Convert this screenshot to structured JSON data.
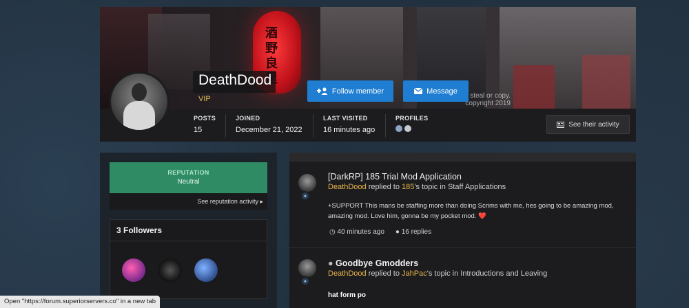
{
  "cover": {
    "lantern_text": "酒野良里",
    "watermark_line1": "steal or copy.",
    "watermark_line2": "copyright 2019"
  },
  "profile": {
    "username": "DeathDood",
    "usergroup": "VIP",
    "follow_label": "Follow member",
    "message_label": "Message",
    "stats": [
      {
        "key": "POSTS",
        "value": "15"
      },
      {
        "key": "JOINED",
        "value": "December 21, 2022"
      },
      {
        "key": "LAST VISITED",
        "value": "16 minutes ago"
      },
      {
        "key": "PROFILES",
        "value": ""
      }
    ],
    "activity_label": "See their activity"
  },
  "reputation": {
    "label": "REPUTATION",
    "value": "Neutral",
    "link": "See reputation activity"
  },
  "followers": {
    "title": "3 Followers"
  },
  "feed": [
    {
      "title": "[DarkRP] 185 Trial Mod Application",
      "author": "DeathDood",
      "verb": " replied to ",
      "target_user": "185",
      "suffix": "'s topic in Staff Applications",
      "body": "+SUPPORT This mans be staffing more than doing Scrims with me, hes going to be amazing mod, amazing mod. Love him, gonna be my pocket mod. ",
      "heart": "❤️",
      "time": "40 minutes ago",
      "replies": "16 replies"
    },
    {
      "title": "Goodbye Gmodders",
      "author": "DeathDood",
      "verb": " replied to ",
      "target_user": "JahPac",
      "suffix": "'s topic in Introductions and Leaving",
      "snippet": "hat form po"
    }
  ],
  "status_bar": "Open \"https://forum.superiorservers.co\" in a new tab",
  "colors": {
    "accent": "#1f7ed1",
    "reputation": "#2e8b64",
    "highlight": "#e8b54a",
    "vip": "#e3c15a"
  }
}
